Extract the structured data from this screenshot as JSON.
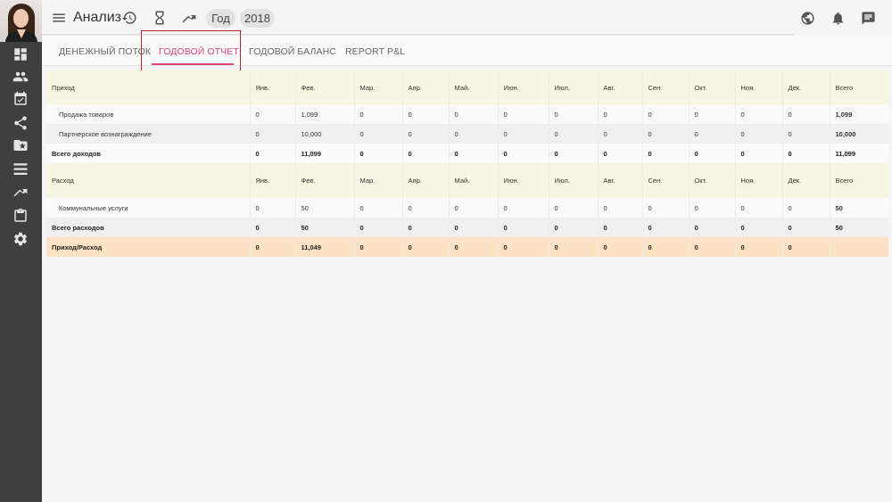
{
  "header": {
    "title": "Анализ",
    "period_chip": "Год",
    "year_chip": "2018"
  },
  "tabs": [
    {
      "label": "ДЕНЕЖНЫЙ ПОТОК",
      "active": false
    },
    {
      "label": "ГОДОВОЙ ОТЧЕТ",
      "active": true
    },
    {
      "label": "ГОДОВОЙ БАЛАНС",
      "active": false
    },
    {
      "label": "REPORT P&L",
      "active": false
    }
  ],
  "colors": {
    "accent": "#e0457b",
    "highlight_border": "#b9272f",
    "header_row_bg": "#f6f6e2",
    "net_row_bg": "#fde2c6",
    "sidebar_bg": "#3f3f3f"
  },
  "table": {
    "months": [
      "Янв.",
      "Фев.",
      "Мар.",
      "Апр.",
      "Май.",
      "Июн.",
      "Июл.",
      "Авг.",
      "Сен.",
      "Окт.",
      "Ноя.",
      "Дек."
    ],
    "total_label": "Всего",
    "income": {
      "section_label": "Приход",
      "rows": [
        {
          "label": "Продажа товаров",
          "values": [
            "0",
            "1,099",
            "0",
            "0",
            "0",
            "0",
            "0",
            "0",
            "0",
            "0",
            "0",
            "0"
          ],
          "total": "1,099"
        },
        {
          "label": "Партнерское вознаграждение",
          "values": [
            "0",
            "10,000",
            "0",
            "0",
            "0",
            "0",
            "0",
            "0",
            "0",
            "0",
            "0",
            "0"
          ],
          "total": "10,000"
        }
      ],
      "total_row": {
        "label": "Всего доходов",
        "values": [
          "0",
          "11,099",
          "0",
          "0",
          "0",
          "0",
          "0",
          "0",
          "0",
          "0",
          "0",
          "0"
        ],
        "total": "11,099"
      }
    },
    "expense": {
      "section_label": "Расход",
      "rows": [
        {
          "label": "Коммунальные услуги",
          "values": [
            "0",
            "50",
            "0",
            "0",
            "0",
            "0",
            "0",
            "0",
            "0",
            "0",
            "0",
            "0"
          ],
          "total": "50"
        }
      ],
      "total_row": {
        "label": "Всего расходов",
        "values": [
          "0",
          "50",
          "0",
          "0",
          "0",
          "0",
          "0",
          "0",
          "0",
          "0",
          "0",
          "0"
        ],
        "total": "50"
      }
    },
    "net_row": {
      "label": "Приход/Расход",
      "values": [
        "0",
        "11,049",
        "0",
        "0",
        "0",
        "0",
        "0",
        "0",
        "0",
        "0",
        "0",
        "0"
      ],
      "total": ""
    }
  }
}
